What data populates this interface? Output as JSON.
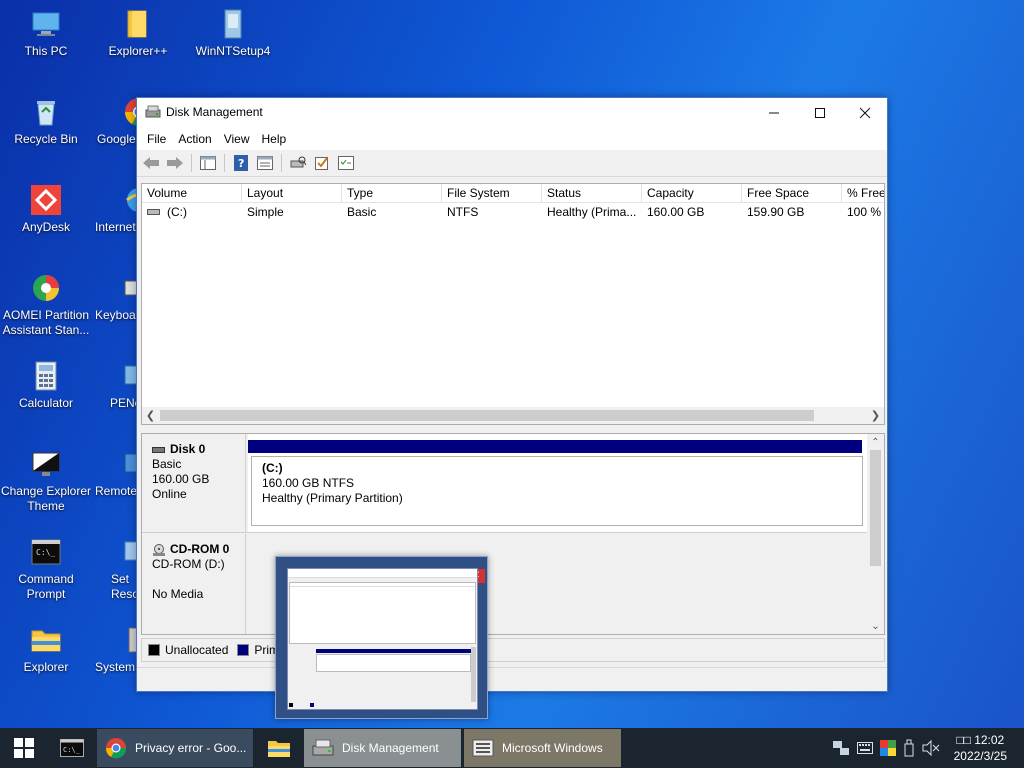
{
  "desktop": {
    "icons": [
      {
        "label": "This PC",
        "icon": "computer-icon"
      },
      {
        "label": "Explorer++",
        "icon": "folder-icon"
      },
      {
        "label": "WinNTSetup4",
        "icon": "setup-icon"
      },
      {
        "label": "Recycle Bin",
        "icon": "recycle-bin-icon"
      },
      {
        "label": "Google",
        "icon": "chrome-icon"
      },
      {
        "label": "AnyDesk",
        "icon": "anydesk-icon"
      },
      {
        "label": "Internet",
        "icon": "internet-icon"
      },
      {
        "label": "AOMEI Partition Assistant Stan...",
        "icon": "aomei-icon"
      },
      {
        "label": "Keyboa",
        "icon": "keyboard-icon"
      },
      {
        "label": "Calculator",
        "icon": "calculator-icon"
      },
      {
        "label": "PENe",
        "icon": "penetwork-icon"
      },
      {
        "label": "Change Explorer Theme",
        "icon": "theme-icon"
      },
      {
        "label": "Remote",
        "icon": "remote-icon"
      },
      {
        "label": "Command Prompt",
        "icon": "cmd-icon"
      },
      {
        "label": "Set Reso",
        "icon": "display-icon"
      },
      {
        "label": "Explorer",
        "icon": "explorer-icon"
      },
      {
        "label": "System",
        "icon": "system-icon"
      }
    ]
  },
  "window": {
    "title": "Disk Management",
    "menu": [
      "File",
      "Action",
      "View",
      "Help"
    ],
    "columns": [
      "Volume",
      "Layout",
      "Type",
      "File System",
      "Status",
      "Capacity",
      "Free Space",
      "% Free"
    ],
    "rows": [
      {
        "volume": "(C:)",
        "layout": "Simple",
        "type": "Basic",
        "fs": "NTFS",
        "status": "Healthy (Prima...",
        "capacity": "160.00 GB",
        "free": "159.90 GB",
        "pct": "100 %"
      }
    ],
    "disks": [
      {
        "name": "Disk 0",
        "kind": "Basic",
        "size": "160.00 GB",
        "state": "Online",
        "partition": {
          "label": "(C:)",
          "size_fs": "160.00 GB NTFS",
          "status": "Healthy (Primary Partition)"
        }
      },
      {
        "name": "CD-ROM 0",
        "kind": "CD-ROM (D:)",
        "state": "No Media"
      }
    ],
    "legend": [
      {
        "label": "Unallocated",
        "color": "#000000"
      },
      {
        "label": "Prima",
        "color": "#00007f"
      }
    ]
  },
  "taskbar": {
    "apps": [
      {
        "label": "Privacy error - Goo...",
        "icon": "chrome-icon"
      },
      {
        "label": "",
        "icon": "file-explorer-icon"
      },
      {
        "label": "Disk Management",
        "icon": "disk-management-icon"
      },
      {
        "label": "Microsoft Windows",
        "icon": "windows-setup-icon"
      }
    ],
    "clock": {
      "time": "□□ 12:02",
      "date": "2022/3/25"
    }
  },
  "colors": {
    "desktop": "#1565d8",
    "primary_partition": "#00007f",
    "taskbar": "#1b2530"
  }
}
